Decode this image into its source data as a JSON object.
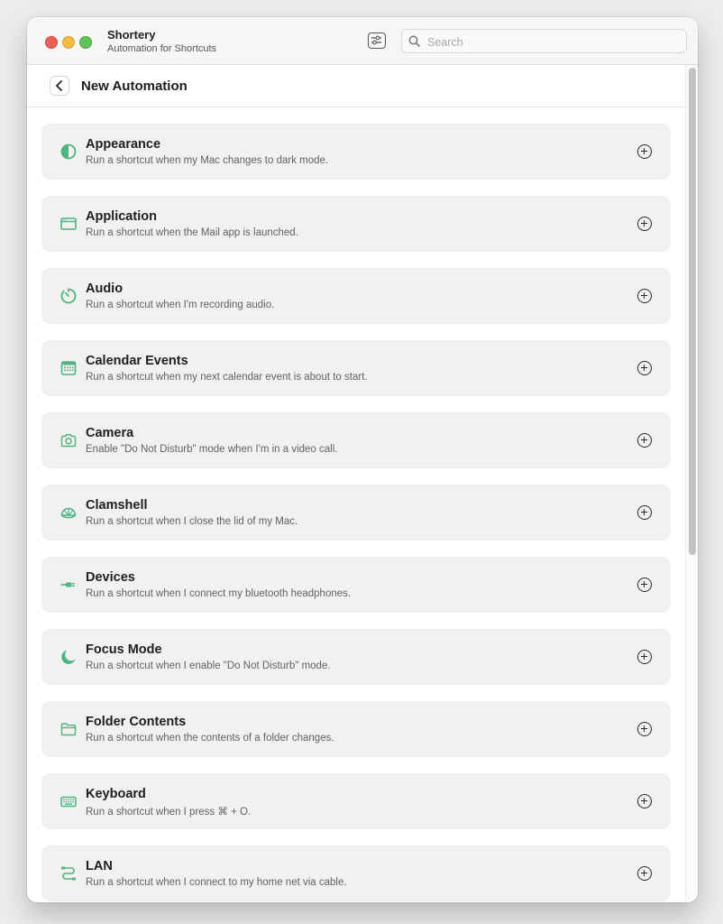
{
  "app": {
    "title": "Shortery",
    "subtitle": "Automation for Shortcuts"
  },
  "search": {
    "placeholder": "Search",
    "value": ""
  },
  "header": {
    "title": "New Automation"
  },
  "colors": {
    "accent": "#4fb57f"
  },
  "automations": [
    {
      "icon": "half-circle-icon",
      "title": "Appearance",
      "description": "Run a shortcut when my Mac changes to dark mode."
    },
    {
      "icon": "app-window-icon",
      "title": "Application",
      "description": "Run a shortcut when the Mail app is launched."
    },
    {
      "icon": "audio-timer-icon",
      "title": "Audio",
      "description": "Run a shortcut when I'm recording audio."
    },
    {
      "icon": "calendar-icon",
      "title": "Calendar Events",
      "description": "Run a shortcut when my next calendar event is about to start."
    },
    {
      "icon": "camera-icon",
      "title": "Camera",
      "description": "Enable \"Do Not Disturb\" mode when I'm in a video call."
    },
    {
      "icon": "clamshell-icon",
      "title": "Clamshell",
      "description": "Run a shortcut when I close the lid of my Mac."
    },
    {
      "icon": "connector-icon",
      "title": "Devices",
      "description": "Run a shortcut when I connect my bluetooth headphones."
    },
    {
      "icon": "moon-icon",
      "title": "Focus Mode",
      "description": "Run a shortcut when I enable \"Do Not Disturb\" mode."
    },
    {
      "icon": "folder-icon",
      "title": "Folder Contents",
      "description": "Run a shortcut when the contents of a folder changes."
    },
    {
      "icon": "keyboard-icon",
      "title": "Keyboard",
      "description": "Run a shortcut when I press ⌘ + O."
    },
    {
      "icon": "cable-icon",
      "title": "LAN",
      "description": "Run a shortcut when I connect to my home net via cable."
    }
  ]
}
